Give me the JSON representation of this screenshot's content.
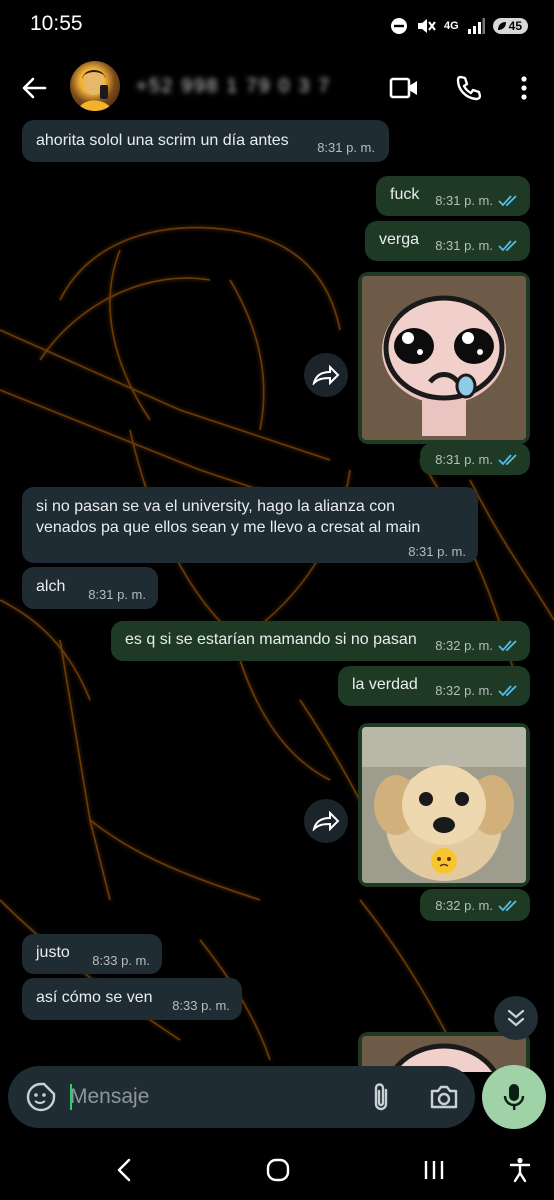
{
  "status_bar": {
    "time": "10:55",
    "network": "4G",
    "battery": "45"
  },
  "header": {
    "contact_name": "+52 998 1 79 0 3 7"
  },
  "messages": [
    {
      "direction": "in",
      "text": "ahorita solol una scrim un día antes",
      "time": "8:31 p. m."
    },
    {
      "direction": "out",
      "text": "fuck",
      "time": "8:31 p. m.",
      "status": "read"
    },
    {
      "direction": "out",
      "text": "verga",
      "time": "8:31 p. m.",
      "status": "read"
    },
    {
      "direction": "out",
      "type": "sticker",
      "sticker": "crying-isaac-sticker",
      "time": "8:31 p. m.",
      "status": "read"
    },
    {
      "direction": "in",
      "text_line1": "si no pasan se va el university, hago la alianza con",
      "text_line2": "venados pa que ellos sean y me llevo a cresat al main",
      "time": "8:31 p. m."
    },
    {
      "direction": "in",
      "text": "alch",
      "time": "8:31 p. m."
    },
    {
      "direction": "out",
      "text": "es q si se estarían mamando si no pasan",
      "time": "8:32 p. m.",
      "status": "read"
    },
    {
      "direction": "out",
      "text": "la verdad",
      "time": "8:32 p. m.",
      "status": "read"
    },
    {
      "direction": "out",
      "type": "sticker",
      "sticker": "puppy-pleading-sticker",
      "time": "8:32 p. m.",
      "status": "read"
    },
    {
      "direction": "in",
      "text": "justo",
      "time": "8:33 p. m."
    },
    {
      "direction": "in",
      "text": "así cómo se ven",
      "time": "8:33 p. m."
    }
  ],
  "composer": {
    "placeholder": "Mensaje"
  },
  "colors": {
    "incoming_bubble": "#1f2c33",
    "outgoing_bubble": "#1f3a24",
    "read_ticks": "#53bdeb",
    "mic_button": "#9fd3a7",
    "wallpaper_accent": "#d4740f"
  },
  "icons": [
    "back-arrow-icon",
    "video-call-icon",
    "phone-icon",
    "more-vert-icon",
    "forward-icon",
    "chevron-double-down-icon",
    "sticker-icon",
    "paperclip-icon",
    "camera-icon",
    "mic-icon",
    "nav-back-icon",
    "nav-home-icon",
    "nav-recents-icon",
    "accessibility-icon"
  ]
}
